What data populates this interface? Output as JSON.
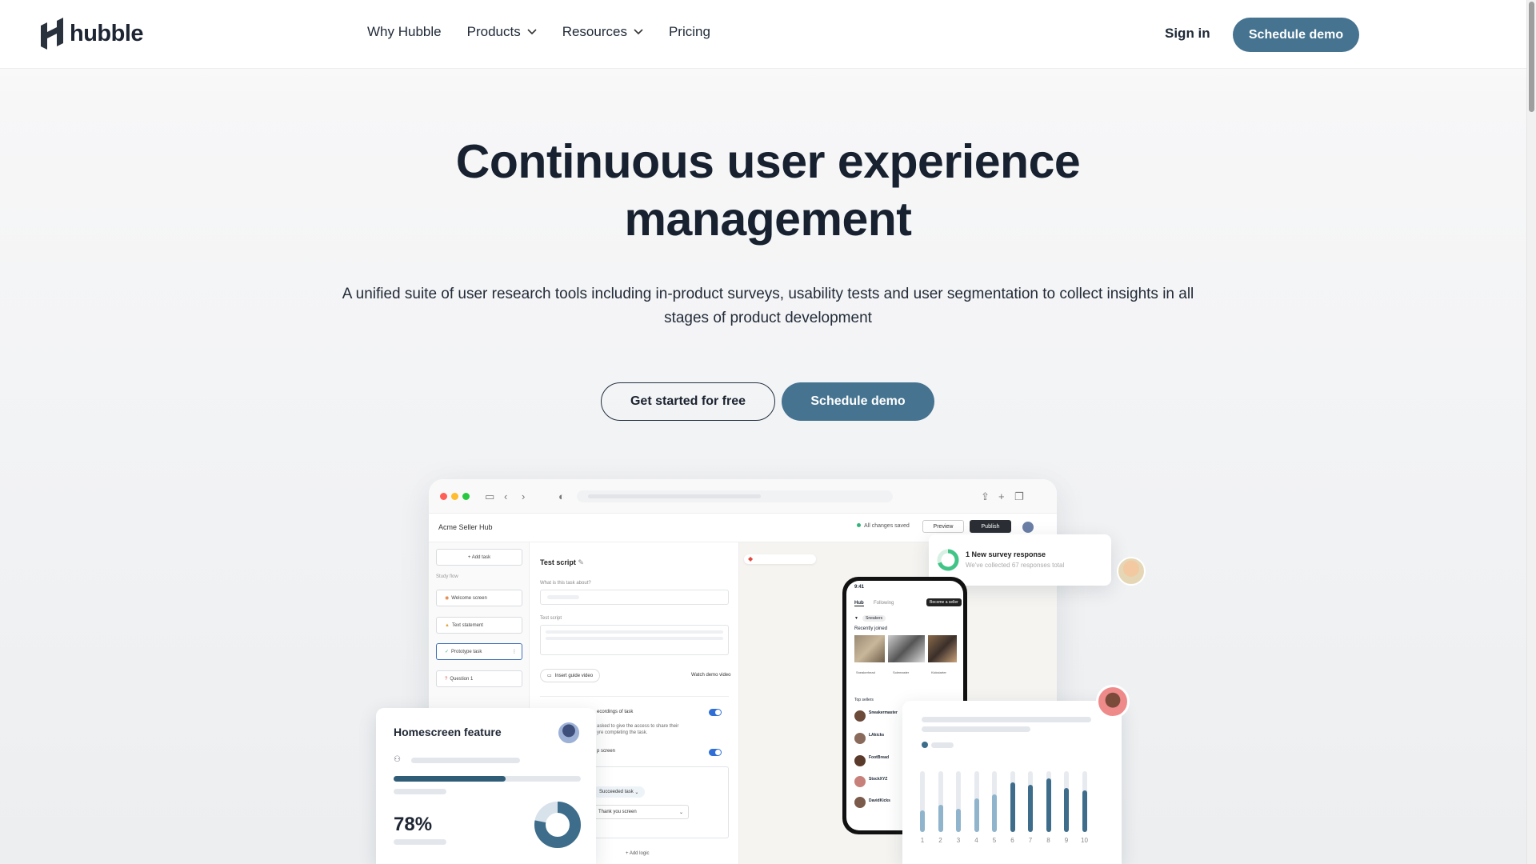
{
  "brand": {
    "name": "hubble"
  },
  "nav": {
    "links": [
      {
        "label": "Why Hubble",
        "dropdown": false
      },
      {
        "label": "Products",
        "dropdown": true
      },
      {
        "label": "Resources",
        "dropdown": true
      },
      {
        "label": "Pricing",
        "dropdown": false
      }
    ],
    "sign_in": "Sign in",
    "cta": "Schedule demo"
  },
  "hero": {
    "title_line1": "Continuous user experience",
    "title_line2": "management",
    "subtitle": "A unified suite of user research tools including in-product surveys, usability tests and user segmentation to collect insights in all stages of product development",
    "cta_secondary": "Get started for free",
    "cta_primary": "Schedule demo"
  },
  "mock": {
    "app_title": "Acme Seller Hub",
    "saved_status": "All changes saved",
    "preview_label": "Preview",
    "publish_label": "Publish",
    "add_task": "+ Add task",
    "study_flow_label": "Study flow",
    "tasks": [
      "Welcome screen",
      "Text statement",
      "Prototype task",
      "Question 1"
    ],
    "editor_title": "Test script",
    "q_label": "What is this task about?",
    "script_label": "Test script",
    "insert_video": "Insert guide video",
    "watch_demo": "Watch demo video",
    "recordings_text": "ecordings of task",
    "access_text": "asked to give the access to share their\nyre completing the task.",
    "screen_text": "p screen",
    "succeeded_task": "Succeeded task",
    "thank_you": "Thank you screen",
    "add_logic": "+ Add logic",
    "notification": {
      "title": "1 New survey response",
      "subtitle": "We've collected 67 responses total"
    },
    "phone": {
      "time": "9:41",
      "tabs": [
        "Hub",
        "Following"
      ],
      "become_seller": "Become a seller",
      "filter": "Sneakers",
      "recently_joined": "Recently joined",
      "joined_names": [
        "Sneakerhead",
        "Solemaster",
        "Kickstarter"
      ],
      "top_sellers": "Top sellers",
      "sellers": [
        "Sneakermaster",
        "LAkicks",
        "FootBread",
        "StockXYZ",
        "DavidKicks"
      ]
    },
    "feature_card": {
      "title": "Homescreen feature",
      "percent": "78%",
      "progress": 0.6,
      "donut": 0.78
    },
    "bar_chart": {
      "categories": [
        "1",
        "2",
        "3",
        "4",
        "5",
        "6",
        "7",
        "8",
        "9",
        "10"
      ],
      "values": [
        0.35,
        0.45,
        0.38,
        0.55,
        0.62,
        0.82,
        0.78,
        0.88,
        0.72,
        0.68
      ],
      "highlight_from": 6,
      "colors": {
        "light": "#8fb4cb",
        "dark": "#3d6d8a",
        "track": "#e7ebef"
      }
    }
  },
  "colors": {
    "accent": "#457390",
    "text": "#172130"
  }
}
